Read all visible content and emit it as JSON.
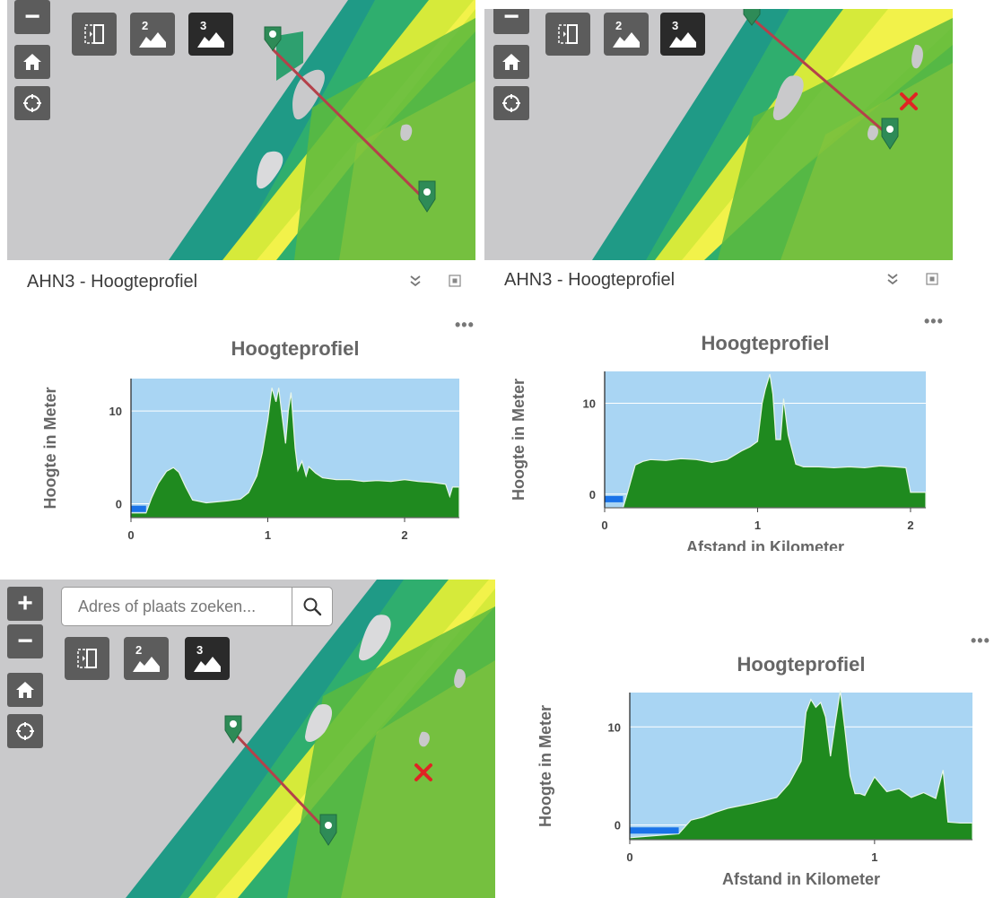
{
  "panels": {
    "header_title": "AHN3 - Hoogteprofiel",
    "collapse_icon": "double-chevron-down-icon",
    "maximize_icon": "maximize-icon",
    "more_menu": "•••"
  },
  "map_controls": {
    "zoom_in": "+",
    "zoom_out": "−",
    "home_icon": "home-icon",
    "locate_icon": "locate-icon",
    "compare_icon": "swipe-compare-icon",
    "profile_2_label": "2",
    "profile_3_label": "3"
  },
  "search": {
    "placeholder": "Adres of plaats zoeken...",
    "button_icon": "search-icon"
  },
  "colors": {
    "chart_sky": "#a9d5f3",
    "chart_ground": "#1f8a1f",
    "chart_water": "#1a73e8",
    "map_land": "#cacacc",
    "profile_line": "#b4414a",
    "marker": "#2e8b57",
    "remove_marker": "#e02424"
  },
  "chart_data": [
    {
      "type": "area",
      "title": "Hoogteprofiel",
      "xlabel": "",
      "ylabel": "Hoogte in Meter",
      "xlim": [
        0,
        2.4
      ],
      "ylim": [
        -1.5,
        13.5
      ],
      "xticks": [
        "0",
        "1",
        "2"
      ],
      "yticks": [
        "0",
        "10"
      ],
      "water": [
        [
          0,
          -0.7
        ],
        [
          0.11,
          -0.7
        ]
      ],
      "x": [
        0,
        0.11,
        0.15,
        0.2,
        0.26,
        0.31,
        0.35,
        0.4,
        0.45,
        0.55,
        0.7,
        0.8,
        0.86,
        0.92,
        0.96,
        1.0,
        1.03,
        1.06,
        1.08,
        1.1,
        1.13,
        1.15,
        1.17,
        1.2,
        1.22,
        1.25,
        1.28,
        1.3,
        1.35,
        1.4,
        1.5,
        1.6,
        1.7,
        1.8,
        1.9,
        2.0,
        2.1,
        2.2,
        2.3,
        2.33,
        2.35,
        2.4
      ],
      "y": [
        -1.0,
        -1.0,
        0.6,
        2.2,
        3.5,
        3.9,
        3.4,
        1.8,
        0.4,
        0.1,
        0.3,
        0.5,
        1.2,
        3.0,
        5.5,
        9.0,
        12.5,
        11.0,
        12.5,
        10.0,
        6.5,
        10.0,
        12.0,
        6.0,
        3.6,
        4.6,
        3.0,
        4.0,
        3.3,
        2.8,
        2.6,
        2.6,
        2.4,
        2.5,
        2.4,
        2.6,
        2.4,
        2.3,
        2.1,
        0.8,
        1.8,
        1.8
      ]
    },
    {
      "type": "area",
      "title": "Hoogteprofiel",
      "xlabel": "Afstand in Kilometer",
      "ylabel": "Hoogte in Meter",
      "xlim": [
        0,
        2.1
      ],
      "ylim": [
        -1.5,
        13.5
      ],
      "xticks": [
        "0",
        "1",
        "2"
      ],
      "yticks": [
        "0",
        "10"
      ],
      "water": [
        [
          0,
          -0.7
        ],
        [
          0.12,
          -0.7
        ]
      ],
      "x": [
        0,
        0.12,
        0.15,
        0.2,
        0.25,
        0.3,
        0.4,
        0.5,
        0.6,
        0.7,
        0.8,
        0.85,
        0.9,
        0.95,
        1.0,
        1.03,
        1.05,
        1.08,
        1.1,
        1.12,
        1.15,
        1.17,
        1.2,
        1.25,
        1.3,
        1.4,
        1.5,
        1.6,
        1.7,
        1.8,
        1.9,
        1.97,
        2.0,
        2.1
      ],
      "y": [
        -1.5,
        -1.5,
        0.2,
        3.2,
        3.6,
        3.8,
        3.7,
        3.9,
        3.8,
        3.5,
        3.8,
        4.3,
        4.8,
        5.2,
        5.8,
        10.0,
        11.5,
        13.2,
        11.0,
        6.0,
        6.0,
        10.5,
        6.5,
        3.3,
        3.0,
        3.0,
        2.9,
        3.0,
        2.9,
        3.1,
        3.0,
        2.9,
        0.2,
        0.2
      ]
    },
    {
      "type": "area",
      "title": "Hoogteprofiel",
      "xlabel": "Afstand in Kilometer",
      "ylabel": "Hoogte in Meter",
      "xlim": [
        0,
        1.4
      ],
      "ylim": [
        -1.5,
        13.5
      ],
      "xticks": [
        "0",
        "1"
      ],
      "yticks": [
        "0",
        "10"
      ],
      "water": [
        [
          0,
          -0.7
        ],
        [
          0.2,
          -0.7
        ]
      ],
      "x": [
        0,
        0.2,
        0.25,
        0.3,
        0.35,
        0.4,
        0.5,
        0.6,
        0.65,
        0.7,
        0.72,
        0.74,
        0.76,
        0.78,
        0.8,
        0.82,
        0.84,
        0.86,
        0.88,
        0.9,
        0.92,
        0.94,
        0.96,
        1.0,
        1.05,
        1.1,
        1.15,
        1.2,
        1.25,
        1.28,
        1.3,
        1.35,
        1.4
      ],
      "y": [
        -1.3,
        -0.9,
        0.5,
        0.8,
        1.3,
        1.7,
        2.2,
        2.8,
        4.2,
        6.5,
        11.5,
        12.8,
        12.0,
        12.5,
        11.0,
        7.0,
        10.5,
        13.7,
        9.5,
        5.0,
        3.2,
        3.2,
        3.0,
        4.9,
        3.4,
        3.7,
        2.8,
        3.3,
        2.7,
        5.6,
        0.3,
        0.2,
        0.2
      ]
    }
  ]
}
